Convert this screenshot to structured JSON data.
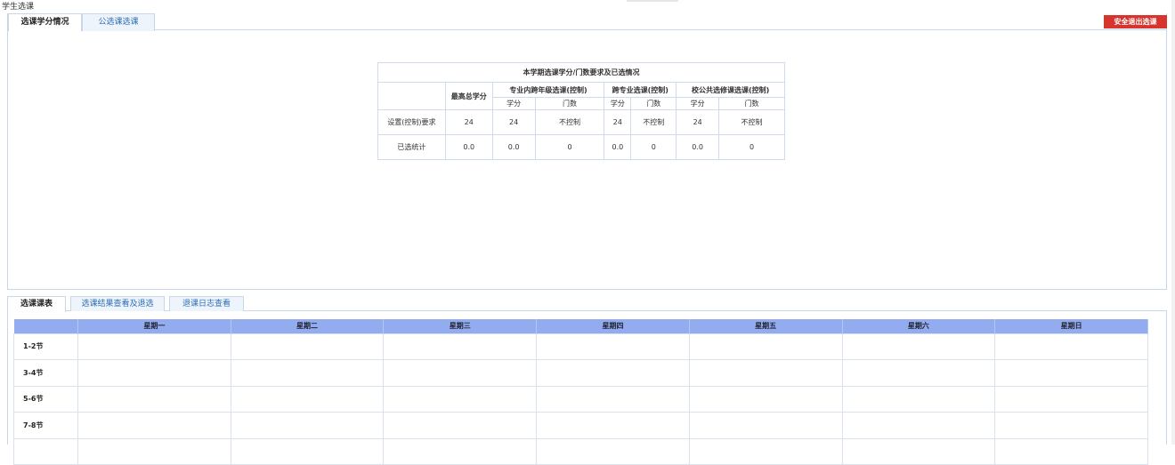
{
  "page": {
    "title": "学生选课"
  },
  "top_tabs": [
    {
      "label": "选课学分情况",
      "active": true
    },
    {
      "label": "公选课选课",
      "active": false
    }
  ],
  "exit_button": {
    "label": "安全退出选课",
    "color": "#d6342c"
  },
  "credit_table": {
    "caption": "本学期选课学分/门数要求及已选情况",
    "group_headers": {
      "max_total": "最高总学分",
      "major_cross_year": "专业内跨年级选课(控制)",
      "cross_major": "跨专业选课(控制)",
      "public_elective": "校公共选修课选课(控制)"
    },
    "sub_headers": {
      "credit": "学分",
      "count": "门数"
    },
    "rows": [
      {
        "label": "设置(控制)要求",
        "values": [
          "24",
          "24",
          "不控制",
          "24",
          "不控制",
          "24",
          "不控制"
        ]
      },
      {
        "label": "已选统计",
        "values": [
          "0.0",
          "0.0",
          "0",
          "0.0",
          "0",
          "0.0",
          "0"
        ]
      }
    ]
  },
  "lower_tabs": [
    {
      "label": "选课课表",
      "active": true
    },
    {
      "label": "选课结果查看及退选",
      "active": false
    },
    {
      "label": "退课日志查看",
      "active": false
    }
  ],
  "schedule": {
    "header_color": "#93acf0",
    "days": [
      "星期一",
      "星期二",
      "星期三",
      "星期四",
      "星期五",
      "星期六",
      "星期日"
    ],
    "periods": [
      "1-2节",
      "3-4节",
      "5-6节",
      "7-8节"
    ]
  }
}
